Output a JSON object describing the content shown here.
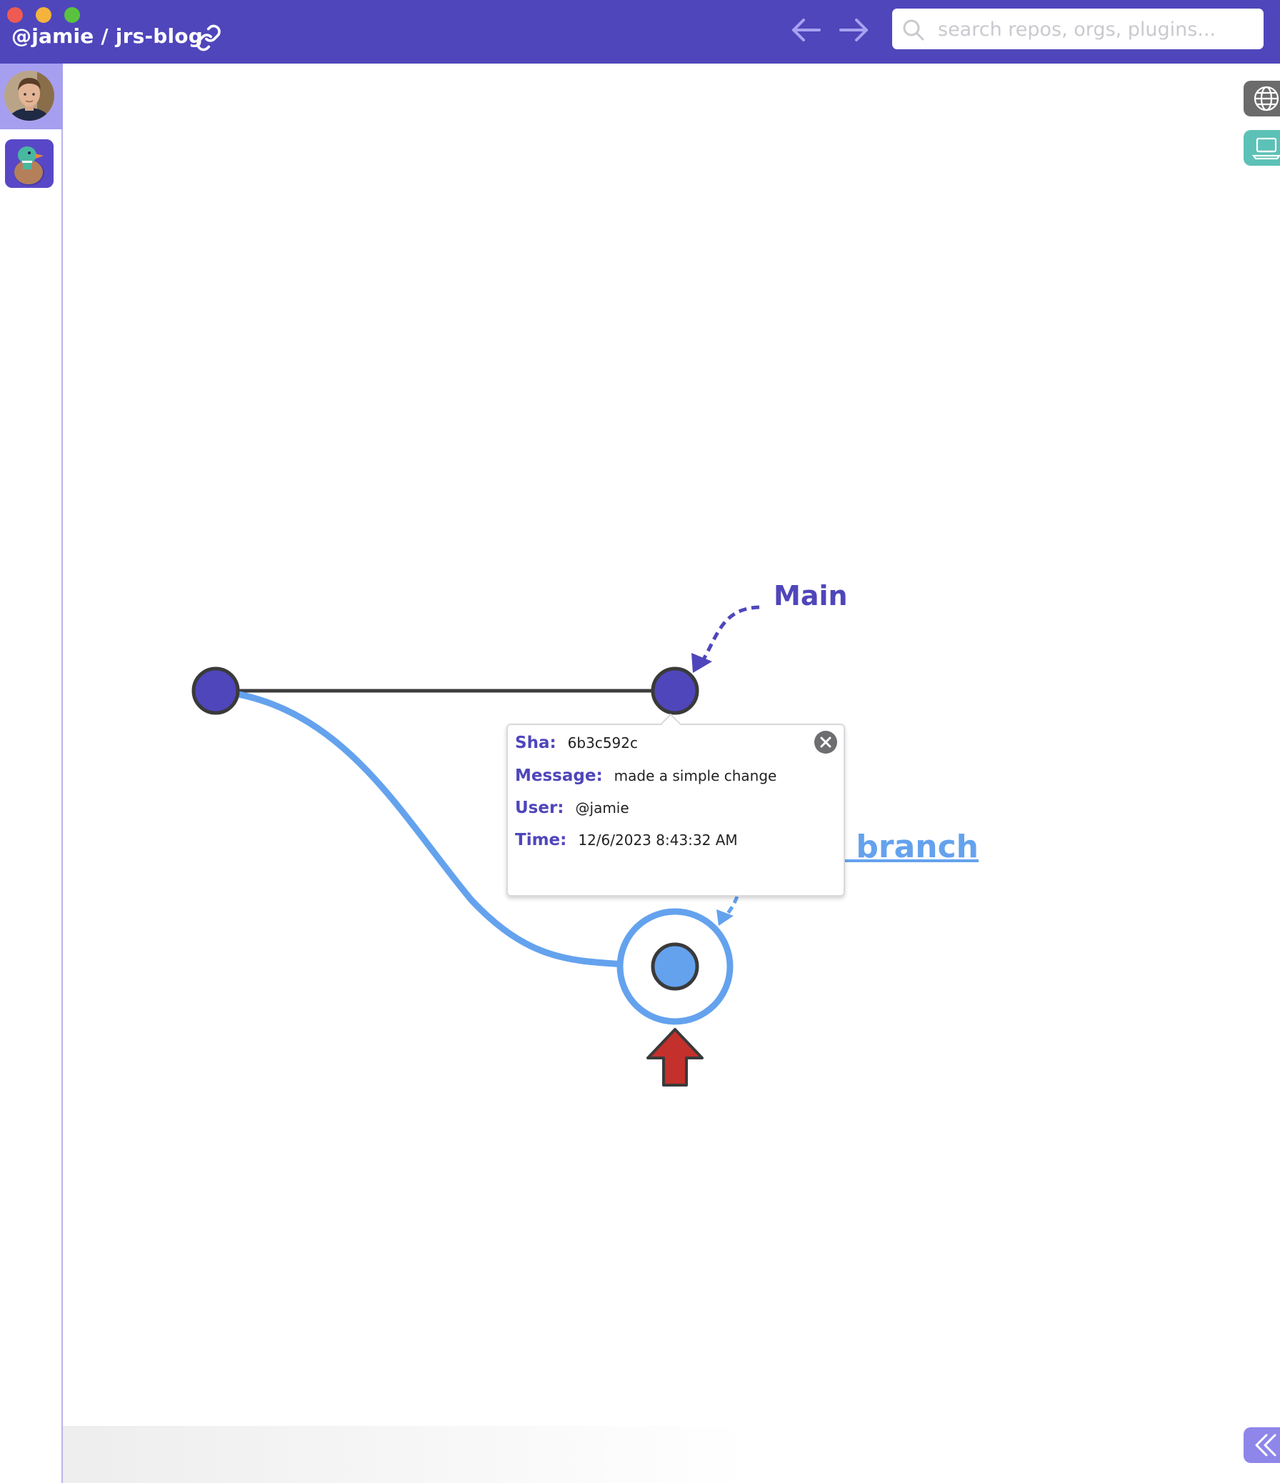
{
  "window": {
    "repo_title": "@jamie / jrs-blog",
    "colors": {
      "titlebar": "#4f46bb",
      "accent": "#4f46bb",
      "branch": "#64a2ee",
      "upload_arrow": "#c4302c"
    }
  },
  "search": {
    "placeholder": "search repos, orgs, plugins..."
  },
  "sidebar": {
    "items": [
      {
        "name": "user-avatar",
        "selected": true
      },
      {
        "name": "duck-app-icon",
        "selected": false
      }
    ]
  },
  "right_panel": {
    "buttons": [
      {
        "icon": "globe-icon"
      },
      {
        "icon": "laptop-icon"
      }
    ],
    "collapse_icon": "double-chevron-left-icon"
  },
  "graph": {
    "branches": {
      "main_label": "Main",
      "test_label": "Test branch"
    },
    "commits": [
      {
        "branch": "main",
        "selected": false
      },
      {
        "branch": "main",
        "selected": false
      },
      {
        "branch": "test",
        "selected": true
      }
    ]
  },
  "commit_popup": {
    "sha_label": "Sha:",
    "sha": "6b3c592c",
    "message_label": "Message:",
    "message": "made a simple change",
    "user_label": "User:",
    "user": "@jamie",
    "time_label": "Time:",
    "time": "12/6/2023 8:43:32 AM"
  }
}
